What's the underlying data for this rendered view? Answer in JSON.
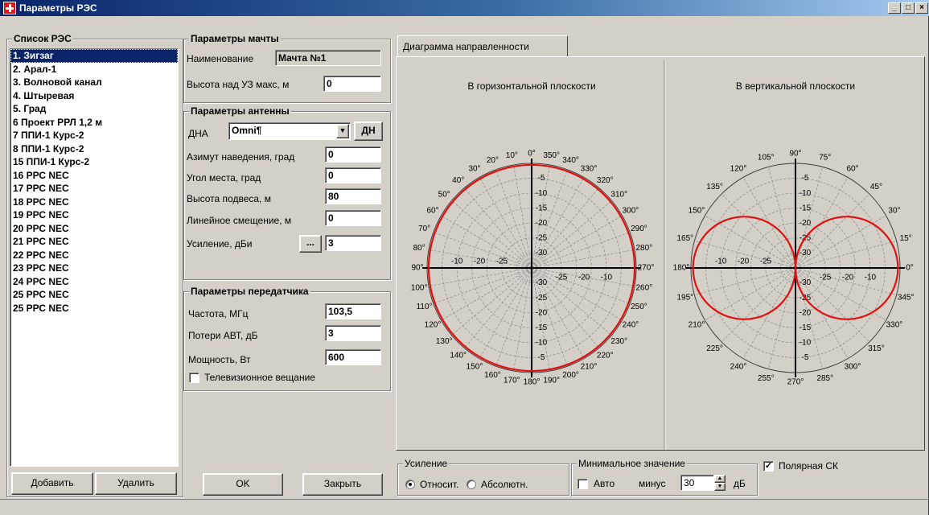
{
  "window": {
    "title": "Параметры РЭС",
    "minimize": "_",
    "maximize": "□",
    "close": "×"
  },
  "res_list": {
    "label": "Список РЭС",
    "items": [
      "1. Зигзаг",
      "2. Арал-1",
      "3. Волновой канал",
      "4. Штыревая",
      "5. Град",
      "6 Проект РРЛ 1,2 м",
      "7 ППИ-1 Курс-2",
      "8 ППИ-1 Курс-2",
      "15 ППИ-1 Курс-2",
      "16 РРС NEC",
      "17 РРС NEC",
      "18 РРС NEC",
      "19 РРС NEC",
      "20 РРС NEC",
      "21 РРС NEC",
      "22 РРС NEC",
      "23 РРС NEC",
      "24 РРС NEC",
      "25 РРС NEC",
      "25 РРС NEC"
    ],
    "selected_index": 0,
    "add_button": "Добавить",
    "delete_button": "Удалить"
  },
  "mast": {
    "label": "Параметры мачты",
    "name_label": "Наименование",
    "name_value": "Мачта №1",
    "height_label": "Высота над УЗ макс, м",
    "height_value": "0"
  },
  "antenna": {
    "label": "Параметры антенны",
    "pattern_label": "ДНА",
    "pattern_value": "Omni¶",
    "pattern_button": "ДН",
    "azimuth_label": "Азимут наведения, град",
    "azimuth_value": "0",
    "elevation_label": "Угол места, град",
    "elevation_value": "0",
    "mount_height_label": "Высота подвеса, м",
    "mount_height_value": "80",
    "offset_label": "Линейное смещение, м",
    "offset_value": "0",
    "gain_label": "Усиление, дБи",
    "gain_button": "...",
    "gain_value": "3"
  },
  "transmitter": {
    "label": "Параметры передатчика",
    "freq_label": "Частота, МГц",
    "freq_value": "103,5",
    "loss_label": "Потери АВТ, дБ",
    "loss_value": "3",
    "power_label": "Мощность, Вт",
    "power_value": "600",
    "tv_label": "Телевизионное вещание",
    "tv_checked": false
  },
  "buttons": {
    "ok": "OK",
    "close": "Закрыть"
  },
  "tab": {
    "label": "Диаграмма направленности"
  },
  "diagram": {
    "horizontal_title": "В горизонтальной плоскости",
    "vertical_title": "В вертикальной плоскости",
    "curve_color": "#e01010",
    "h_angle_labels": [
      "0°",
      "10°",
      "20°",
      "30°",
      "40°",
      "50°",
      "60°",
      "70°",
      "80°",
      "90°",
      "100°",
      "110°",
      "120°",
      "130°",
      "140°",
      "150°",
      "160°",
      "170°",
      "180°",
      "190°",
      "200°",
      "210°",
      "220°",
      "230°",
      "240°",
      "250°",
      "260°",
      "270°",
      "280°",
      "290°",
      "300°",
      "310°",
      "320°",
      "330°",
      "340°",
      "350°"
    ],
    "v_angle_labels": [
      "0°",
      "15°",
      "30°",
      "45°",
      "60°",
      "75°",
      "90°",
      "105°",
      "120°",
      "135°",
      "150°",
      "165°",
      "180°",
      "195°",
      "210°",
      "225°",
      "240°",
      "255°",
      "270°",
      "285°",
      "300°",
      "315°",
      "330°",
      "345°"
    ],
    "axis_ticks": [
      "-5",
      "-10",
      "-15",
      "-20",
      "-25",
      "-30"
    ],
    "horizontal_ticks": [
      "-10",
      "-20",
      "-25"
    ]
  },
  "gain_group": {
    "label": "Усиление",
    "relative": "Относит.",
    "absolute": "Абсолютн.",
    "selected": "relative"
  },
  "min_group": {
    "label": "Минимальное значение",
    "auto_label": "Авто",
    "auto_checked": false,
    "minus_label": "минус",
    "value": "30",
    "unit": "дБ"
  },
  "polar": {
    "label": "Полярная СК",
    "checked": true
  }
}
